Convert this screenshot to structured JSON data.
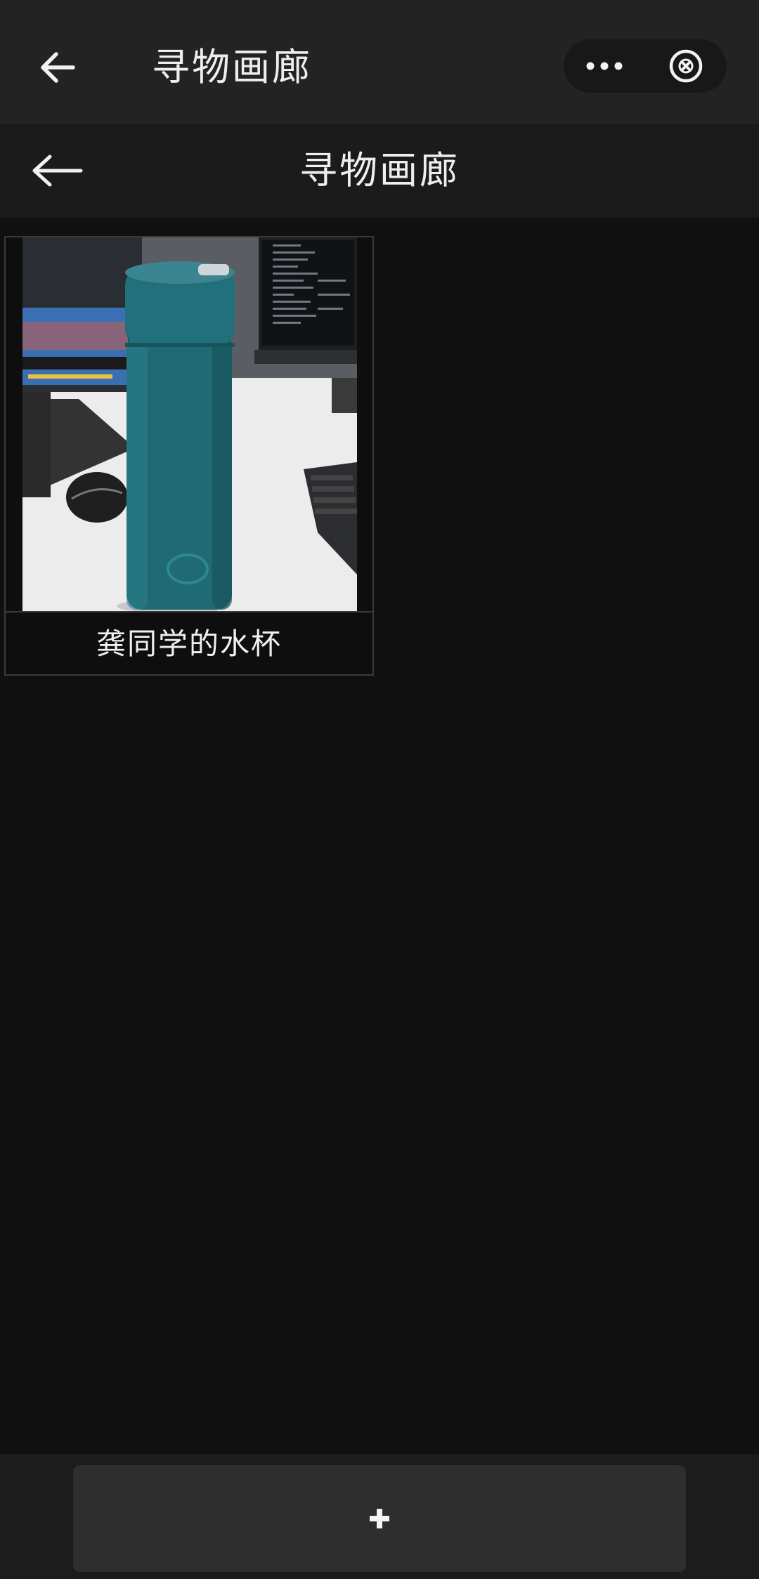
{
  "topbar": {
    "title": "寻物画廊",
    "back_icon": "arrow-left-icon",
    "more_icon": "more-dots-icon",
    "close_icon": "close-circle-icon"
  },
  "navbar": {
    "title": "寻物画廊",
    "back_icon": "arrow-left-icon"
  },
  "gallery": {
    "items": [
      {
        "caption": "龚同学的水杯"
      }
    ]
  },
  "footer": {
    "add_button_label": "+"
  },
  "colors": {
    "background": "#101010",
    "topbar": "#232323",
    "navbar": "#1b1b1b",
    "footer": "#1c1c1c",
    "add_button": "#2e2e2e",
    "text": "#eeeeee",
    "bottle": "#1f6a74"
  }
}
